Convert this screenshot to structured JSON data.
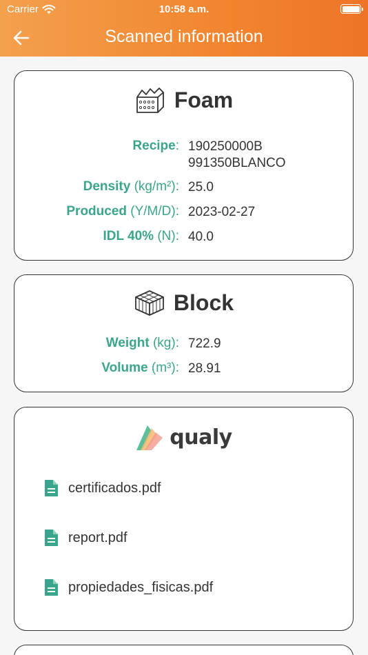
{
  "status_bar": {
    "carrier": "Carrier",
    "time": "10:58 a.m."
  },
  "header": {
    "title": "Scanned information"
  },
  "foam": {
    "title": "Foam",
    "recipe": {
      "label": "Recipe",
      "unit": "",
      "value_line1": "190250000B",
      "value_line2": "991350BLANCO"
    },
    "density": {
      "label": "Density",
      "unit": "(kg/m²)",
      "value": "25.0"
    },
    "produced": {
      "label": "Produced",
      "unit": "(Y/M/D)",
      "value": "2023-02-27"
    },
    "idl": {
      "label": "IDL 40%",
      "unit": "(N)",
      "value": "40.0"
    }
  },
  "block": {
    "title": "Block",
    "weight": {
      "label": "Weight",
      "unit": "(kg)",
      "value": "722.9"
    },
    "volume": {
      "label": "Volume",
      "unit": "(m³)",
      "value": "28.91"
    }
  },
  "qualy": {
    "logo_text": "qualy",
    "files": [
      "certificados.pdf",
      "report.pdf",
      "propiedades_fisicas.pdf"
    ]
  },
  "colors": {
    "accent": "#3aa58c",
    "header_start": "#f3a04d",
    "header_end": "#ee7428"
  }
}
